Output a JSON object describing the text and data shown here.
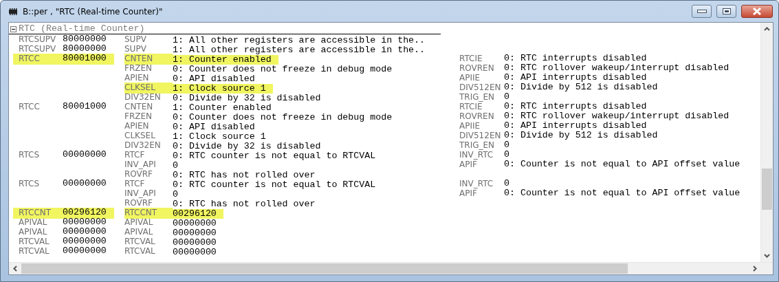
{
  "window": {
    "title": "B::per , \"RTC (Real-time Counter)\""
  },
  "section": {
    "title": "RTC (Real-time Counter)",
    "expanded": true
  },
  "rows": [
    {
      "register": "RTCSUPV",
      "value": "80000000",
      "field": "SUPV",
      "field_value": "1: All other registers are accessible in the..",
      "register_highlighted": false,
      "field_highlighted": false
    },
    {
      "register": "RTCSUPV",
      "value": "80000000",
      "field": "SUPV",
      "field_value": "1: All other registers are accessible in the..",
      "register_highlighted": false,
      "field_highlighted": false
    },
    {
      "register": "RTCC",
      "value": "80001000",
      "field": "CNTEN",
      "field_value": "1: Counter enabled",
      "right_field": "RTCIE",
      "right_value": "0: RTC interrupts disabled",
      "register_highlighted": true,
      "field_highlighted": true
    },
    {
      "field": "FRZEN",
      "field_value": "0: Counter does not freeze in debug mode",
      "right_field": "ROVREN",
      "right_value": "0: RTC rollover wakeup/interrupt disabled",
      "field_highlighted": false
    },
    {
      "field": "APIEN",
      "field_value": "0: API disabled",
      "right_field": "APIIE",
      "right_value": "0: API interrupts disabled",
      "field_highlighted": false
    },
    {
      "field": "CLKSEL",
      "field_value": "1: Clock source 1",
      "right_field": "DIV512EN",
      "right_value": "0: Divide by 512 is disabled",
      "field_highlighted": true
    },
    {
      "field": "DIV32EN",
      "field_value": "0: Divide by 32 is disabled",
      "right_field": "TRIG_EN",
      "right_value": "0",
      "field_highlighted": false
    },
    {
      "register": "RTCC",
      "value": "80001000",
      "field": "CNTEN",
      "field_value": "1: Counter enabled",
      "right_field": "RTCIE",
      "right_value": "0: RTC interrupts disabled",
      "register_highlighted": false,
      "field_highlighted": false
    },
    {
      "field": "FRZEN",
      "field_value": "0: Counter does not freeze in debug mode",
      "right_field": "ROVREN",
      "right_value": "0: RTC rollover wakeup/interrupt disabled",
      "field_highlighted": false
    },
    {
      "field": "APIEN",
      "field_value": "0: API disabled",
      "right_field": "APIIE",
      "right_value": "0: API interrupts disabled",
      "field_highlighted": false
    },
    {
      "field": "CLKSEL",
      "field_value": "1: Clock source 1",
      "right_field": "DIV512EN",
      "right_value": "0: Divide by 512 is disabled",
      "field_highlighted": false
    },
    {
      "field": "DIV32EN",
      "field_value": "0: Divide by 32 is disabled",
      "right_field": "TRIG_EN",
      "right_value": "0",
      "field_highlighted": false
    },
    {
      "register": "RTCS",
      "value": "00000000",
      "field": "RTCF",
      "field_value": "0: RTC counter is not equal to RTCVAL",
      "right_field": "INV_RTC",
      "right_value": "0",
      "register_highlighted": false,
      "field_highlighted": false
    },
    {
      "field": "INV_API",
      "field_value": "0",
      "right_field": "APIF",
      "right_value": "0: Counter is not equal to API offset value",
      "field_highlighted": false
    },
    {
      "field": "ROVRF",
      "field_value": "0: RTC has not rolled over",
      "field_highlighted": false
    },
    {
      "register": "RTCS",
      "value": "00000000",
      "field": "RTCF",
      "field_value": "0: RTC counter is not equal to RTCVAL",
      "right_field": "INV_RTC",
      "right_value": "0",
      "register_highlighted": false,
      "field_highlighted": false
    },
    {
      "field": "INV_API",
      "field_value": "0",
      "right_field": "APIF",
      "right_value": "0: Counter is not equal to API offset value",
      "field_highlighted": false
    },
    {
      "field": "ROVRF",
      "field_value": "0: RTC has not rolled over",
      "field_highlighted": false
    },
    {
      "register": "RTCCNT",
      "value": "00296120",
      "field": "RTCCNT",
      "field_value": "00296120",
      "register_highlighted": true,
      "field_highlighted": true
    },
    {
      "register": "APIVAL",
      "value": "00000000",
      "field": "APIVAL",
      "field_value": "00000000",
      "register_highlighted": false,
      "field_highlighted": false
    },
    {
      "register": "APIVAL",
      "value": "00000000",
      "field": "APIVAL",
      "field_value": "00000000",
      "register_highlighted": false,
      "field_highlighted": false
    },
    {
      "register": "RTCVAL",
      "value": "00000000",
      "field": "RTCVAL",
      "field_value": "00000000",
      "register_highlighted": false,
      "field_highlighted": false
    },
    {
      "register": "RTCVAL",
      "value": "00000000",
      "field": "RTCVAL",
      "field_value": "00000000",
      "register_highlighted": false,
      "field_highlighted": false
    }
  ]
}
